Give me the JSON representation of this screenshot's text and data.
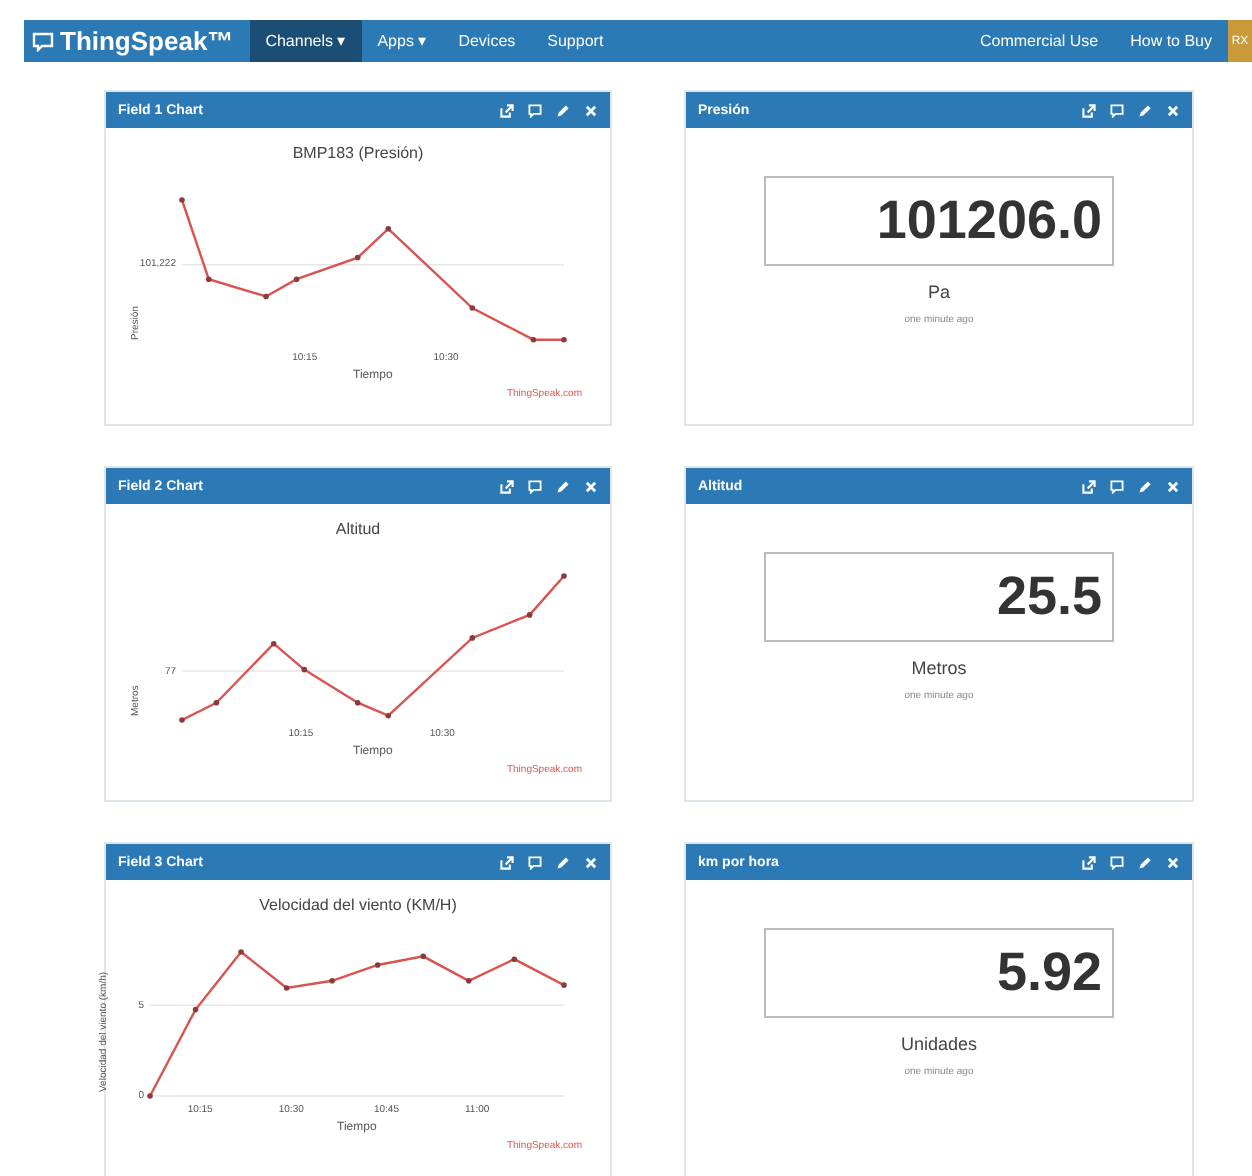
{
  "navbar": {
    "brand": "ThingSpeak™",
    "items": [
      {
        "label": "Channels ▾",
        "selected": true
      },
      {
        "label": "Apps ▾",
        "selected": false
      },
      {
        "label": "Devices",
        "selected": false
      },
      {
        "label": "Support",
        "selected": false
      }
    ],
    "right_items": [
      "Commercial Use",
      "How to Buy"
    ],
    "avatar": "RX"
  },
  "cards": [
    {
      "kind": "chart",
      "title": "Field 1 Chart",
      "chart_title": "BMP183 (Presión)",
      "ylabel": "Presión",
      "yticks": [
        "101,222"
      ],
      "xticks": [
        "10:15",
        "10:30"
      ],
      "xlabel": "Tiempo",
      "credit": "ThingSpeak.com"
    },
    {
      "kind": "display",
      "title": "Presión",
      "value": "101206.0",
      "unit": "Pa",
      "updated": "one minute ago"
    },
    {
      "kind": "chart",
      "title": "Field 2 Chart",
      "chart_title": "Altitud",
      "ylabel": "Metros",
      "yticks": [
        "77"
      ],
      "xticks": [
        "10:15",
        "10:30"
      ],
      "xlabel": "Tiempo",
      "credit": "ThingSpeak.com"
    },
    {
      "kind": "display",
      "title": "Altitud",
      "value": "25.5",
      "unit": "Metros",
      "updated": "one minute ago"
    },
    {
      "kind": "chart",
      "title": "Field 3 Chart",
      "chart_title": "Velocidad del viento (KM/H)",
      "ylabel": "Velocidad del viento (km/h)",
      "yticks": [
        "5",
        "0"
      ],
      "xticks": [
        "10:15",
        "10:30",
        "10:45",
        "11:00"
      ],
      "xlabel": "Tiempo",
      "credit": "ThingSpeak.com"
    },
    {
      "kind": "display",
      "title": "km por hora",
      "value": "5.92",
      "unit": "Unidades",
      "updated": "one minute ago"
    }
  ]
}
